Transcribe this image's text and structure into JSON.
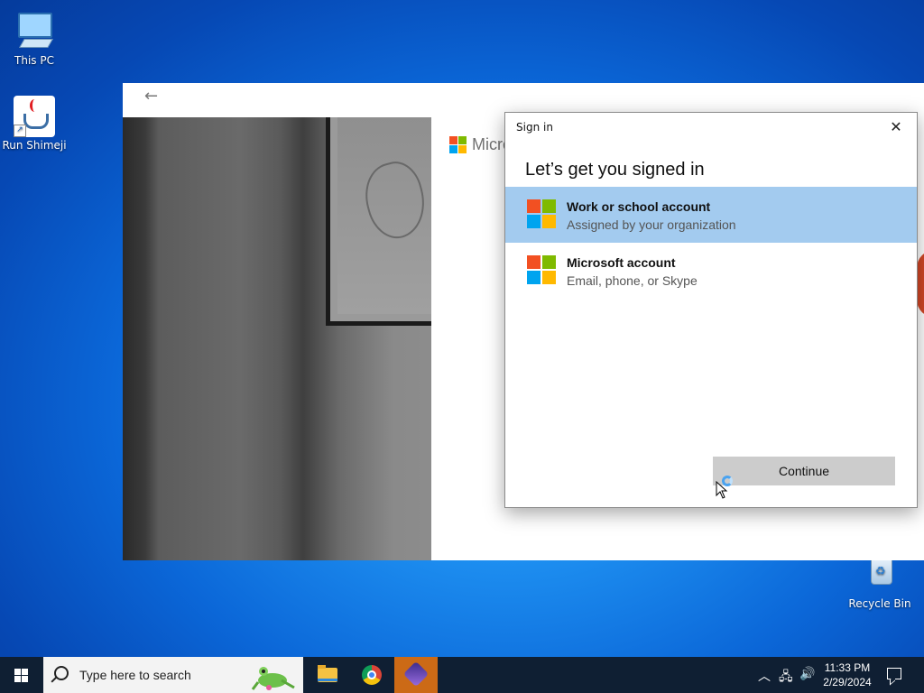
{
  "desktop": {
    "icons": [
      {
        "label": "This PC",
        "icon": "computer-icon"
      },
      {
        "label": "Run Shimeji",
        "icon": "java-icon"
      },
      {
        "label": "Recycle Bin",
        "icon": "recycle-bin-icon"
      }
    ]
  },
  "main_window": {
    "back_icon": "back-arrow-icon",
    "brand_partial": "Micro"
  },
  "dialog": {
    "title": "Sign in",
    "close_icon": "close-icon",
    "heading": "Let’s get you signed in",
    "options": [
      {
        "title": "Work or school account",
        "subtitle": "Assigned by your organization",
        "selected": true
      },
      {
        "title": "Microsoft account",
        "subtitle": "Email, phone, or Skype",
        "selected": false
      }
    ],
    "continue_label": "Continue"
  },
  "colors": {
    "ms_red": "#f25022",
    "ms_green": "#7fba00",
    "ms_blue": "#00a4ef",
    "ms_yellow": "#ffb900",
    "selected_bg": "#a3cbef",
    "taskbar_bg": "#0f1f33",
    "active_app": "#cc6a16"
  },
  "taskbar": {
    "search_placeholder": "Type here to search",
    "apps": [
      "file-explorer-icon",
      "chrome-icon",
      "app-icon"
    ],
    "time": "11:33 PM",
    "date": "2/29/2024"
  }
}
